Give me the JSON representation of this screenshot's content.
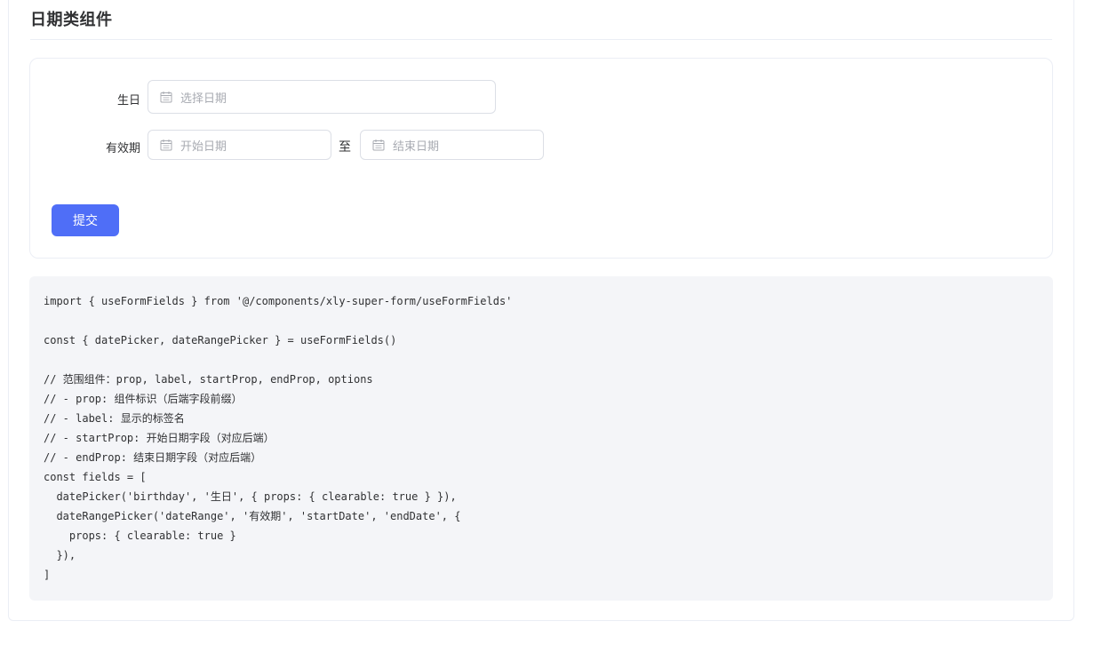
{
  "section": {
    "title": "日期类组件"
  },
  "form": {
    "birthday": {
      "label": "生日",
      "placeholder": "选择日期",
      "icon": "calendar-icon"
    },
    "date_range": {
      "label": "有效期",
      "start_placeholder": "开始日期",
      "separator": "至",
      "end_placeholder": "结束日期",
      "icon": "calendar-icon"
    },
    "submit_label": "提交"
  },
  "code": {
    "lines": [
      "import { useFormFields } from '@/components/xly-super-form/useFormFields'",
      "",
      "const { datePicker, dateRangePicker } = useFormFields()",
      "",
      "// 范围组件：prop, label, startProp, endProp, options",
      "// - prop: 组件标识（后端字段前缀）",
      "// - label: 显示的标签名",
      "// - startProp: 开始日期字段（对应后端）",
      "// - endProp: 结束日期字段（对应后端）",
      "const fields = [",
      "  datePicker('birthday', '生日', { props: { clearable: true } }),",
      "  dateRangePicker('dateRange', '有效期', 'startDate', 'endDate', {",
      "    props: { clearable: true }",
      "  }),",
      "]"
    ]
  },
  "colors": {
    "primary": "#4f6ef7",
    "border": "#dcdfe6",
    "placeholder": "#a8abb2",
    "code_bg": "#f4f5f8"
  }
}
